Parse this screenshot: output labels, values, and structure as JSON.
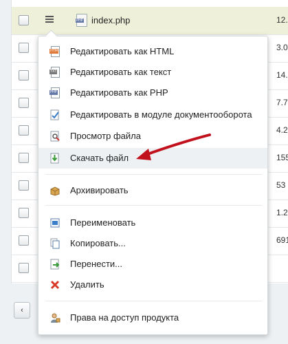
{
  "file_row": {
    "name": "index.php",
    "icon_tag": "PHP"
  },
  "sizes": [
    "12.",
    "3.0",
    "14.",
    "7.7",
    "4.2",
    "155",
    "53",
    "1.2",
    "691",
    ""
  ],
  "pager": {
    "prev": "‹"
  },
  "menu": {
    "items": [
      {
        "label": "Редактировать как HTML",
        "icon": "html-file-icon",
        "tag": "HTM"
      },
      {
        "label": "Редактировать как текст",
        "icon": "text-file-icon",
        "tag": "TXT"
      },
      {
        "label": "Редактировать как PHP",
        "icon": "php-file-icon",
        "tag": "PHP"
      },
      {
        "label": "Редактировать в модуле документооборота",
        "icon": "workflow-icon"
      },
      {
        "label": "Просмотр файла",
        "icon": "view-file-icon"
      },
      {
        "label": "Скачать файл",
        "icon": "download-icon"
      },
      {
        "label": "Архивировать",
        "icon": "archive-icon"
      },
      {
        "label": "Переименовать",
        "icon": "rename-icon"
      },
      {
        "label": "Копировать...",
        "icon": "copy-icon"
      },
      {
        "label": "Перенести...",
        "icon": "move-icon"
      },
      {
        "label": "Удалить",
        "icon": "delete-icon"
      },
      {
        "label": "Права на доступ продукта",
        "icon": "access-rights-icon"
      }
    ],
    "highlighted_index": 5
  },
  "colors": {
    "arrow": "#c0111c",
    "selected_row": "#eef0d9",
    "highlight": "#eef1f3"
  }
}
